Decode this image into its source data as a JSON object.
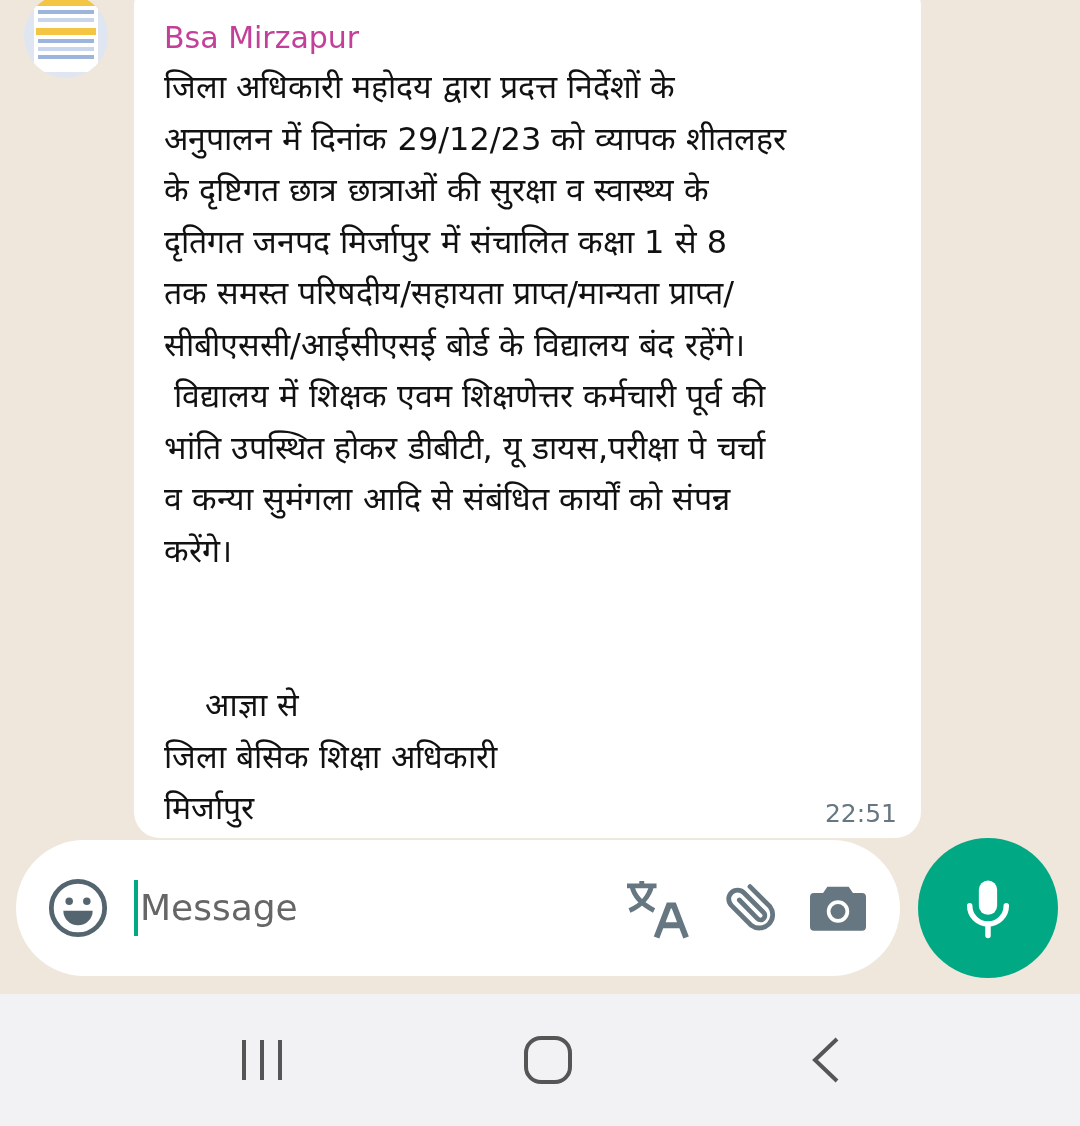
{
  "message": {
    "sender": "Bsa Mirzapur",
    "text": "जिला अधिकारी महोदय द्वारा प्रदत्त निर्देशों के\nअनुपालन में दिनांक 29/12/23 को व्यापक शीतलहर\nके दृष्टिगत छात्र छात्राओं की सुरक्षा व स्वास्थ्य के\nदृतिगत जनपद मिर्जापुर में संचालित कक्षा 1 से 8\nतक समस्त परिषदीय/सहायता प्राप्त/मान्यता प्राप्त/\nसीबीएससी/आईसीएसई बोर्ड के विद्यालय बंद रहेंगे।\n विद्यालय में शिक्षक एवम शिक्षणेत्तर कर्मचारी पूर्व की\nभांति उपस्थित होकर डीबीटी, यू डायस,परीक्षा पे चर्चा\nव कन्या सुमंगला आदि से संबंधित कार्यों को संपन्न\nकरेंगे।\n\n\n    आज्ञा से\nजिला बेसिक शिक्षा अधिकारी\nमिर्जापुर",
    "time": "22:51"
  },
  "composer": {
    "placeholder": "Message"
  }
}
